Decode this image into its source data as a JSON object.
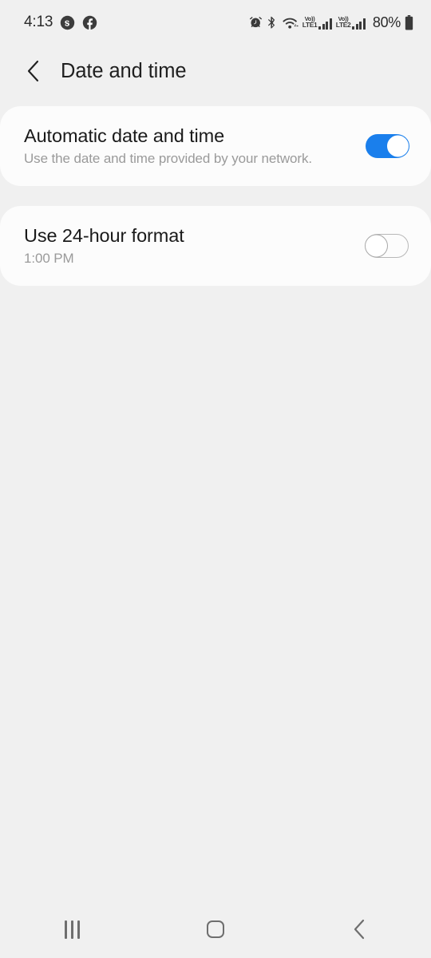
{
  "status_bar": {
    "clock": "4:13",
    "left_icons": [
      "skype-icon",
      "facebook-icon"
    ],
    "right_icons": [
      "alarm-icon",
      "bluetooth-icon",
      "wifi-calling-icon"
    ],
    "sim1_label_top": "Vo))",
    "sim1_label_bottom": "LTE1",
    "sim2_label_top": "Vo))",
    "sim2_label_bottom": "LTE2",
    "battery_percent": "80%",
    "battery_icon": "battery-icon"
  },
  "header": {
    "back_icon": "back-chevron-icon",
    "title": "Date and time"
  },
  "settings": [
    {
      "title": "Automatic date and time",
      "subtitle": "Use the date and time provided by your network.",
      "toggle_state": "on"
    },
    {
      "title": "Use 24-hour format",
      "subtitle": "1:00 PM",
      "toggle_state": "off"
    }
  ],
  "nav_bar": {
    "recents_label": "recents-icon",
    "home_label": "home-icon",
    "back_label": "back-icon"
  },
  "colors": {
    "background": "#f0f0f0",
    "card": "#fcfcfc",
    "toggle_on": "#1a7fec",
    "toggle_off_border": "#b8b8b8",
    "title_text": "#1a1a1a",
    "subtitle_text": "#9a9a9a"
  }
}
